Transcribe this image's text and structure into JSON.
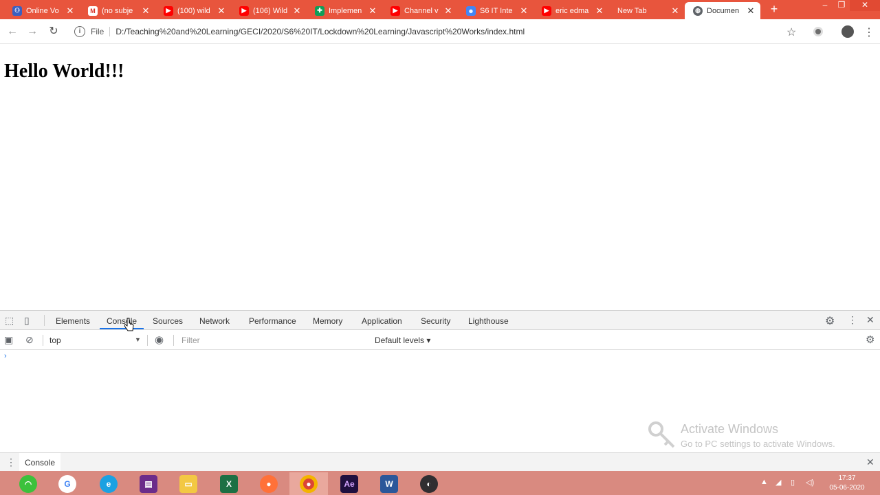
{
  "browser": {
    "tabs": [
      {
        "label": "Online Vo",
        "icon": "team-icon",
        "color": "#3b5fc0"
      },
      {
        "label": "(no subje",
        "icon": "gmail-icon",
        "color": "#ffffff"
      },
      {
        "label": "(100) wild",
        "icon": "youtube-icon",
        "color": "#ff0000"
      },
      {
        "label": "(106) Wild",
        "icon": "youtube-icon",
        "color": "#ff0000"
      },
      {
        "label": "Implemen",
        "icon": "sheets-plus-icon",
        "color": "#0f9d58"
      },
      {
        "label": "Channel v",
        "icon": "youtube-icon",
        "color": "#ff0000"
      },
      {
        "label": "S6 IT Inte",
        "icon": "contacts-icon",
        "color": "#4285f4"
      },
      {
        "label": "eric edma",
        "icon": "youtube-icon",
        "color": "#ff0000"
      },
      {
        "label": "New Tab",
        "icon": "",
        "color": ""
      },
      {
        "label": "Documen",
        "icon": "globe-icon",
        "color": "#5f6368"
      }
    ],
    "address": {
      "scheme_label": "File",
      "url": "D:/Teaching%20and%20Learning/GECI/2020/S6%20IT/Lockdown%20Learning/Javascript%20Works/index.html"
    }
  },
  "page": {
    "heading": "Hello World!!!"
  },
  "devtools": {
    "tabs": [
      "Elements",
      "Console",
      "Sources",
      "Network",
      "Performance",
      "Memory",
      "Application",
      "Security",
      "Lighthouse"
    ],
    "active_tab": "Console",
    "context": "top",
    "filter_placeholder": "Filter",
    "levels": "Default levels ▾",
    "prompt": "›",
    "drawer_tab": "Console"
  },
  "watermark": {
    "title": "Activate Windows",
    "subtitle": "Go to PC settings to activate Windows."
  },
  "taskbar": {
    "apps": [
      "wifi-icon",
      "google-icon",
      "ie-icon",
      "winrar-icon",
      "file-explorer-icon",
      "excel-icon",
      "firefox-icon",
      "chrome-icon",
      "after-effects-icon",
      "word-icon",
      "obs-icon"
    ],
    "active_app": "chrome-icon",
    "time": "17:37",
    "date": "05-06-2020"
  },
  "colors": {
    "tabstrip": "#e8553d",
    "taskbar": "#d98a80",
    "accent": "#1a73e8"
  }
}
